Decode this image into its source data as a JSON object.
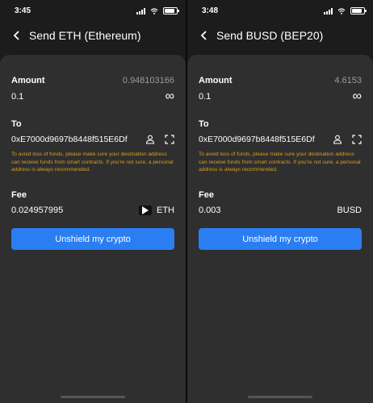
{
  "screens": [
    {
      "status_time": "3:45",
      "title": "Send ETH (Ethereum)",
      "amount_label": "Amount",
      "amount_balance": "0.948103166",
      "amount_value": "0.1",
      "max_symbol": "∞",
      "to_label": "To",
      "to_address": "0xE7000d9697b8448f515E6Df",
      "warning": "To avoid loss of funds, please make sure your destination address can receive funds from smart contracts. If you're not sure, a personal address is always recommended.",
      "fee_label": "Fee",
      "fee_value": "0.024957995",
      "fee_token": "ETH",
      "button_label": "Unshield my crypto",
      "has_token_icon": true
    },
    {
      "status_time": "3:48",
      "title": "Send BUSD (BEP20)",
      "amount_label": "Amount",
      "amount_balance": "4.6153",
      "amount_value": "0.1",
      "max_symbol": "∞",
      "to_label": "To",
      "to_address": "0xE7000d9697b8448f515E6Df",
      "warning": "To avoid loss of funds, please make sure your destination address can receive funds from smart contracts. If you're not sure, a personal address is always recommended.",
      "fee_label": "Fee",
      "fee_value": "0.003",
      "fee_token": "BUSD",
      "button_label": "Unshield my crypto",
      "has_token_icon": false
    }
  ],
  "colors": {
    "accent": "#2a7ef2",
    "warning": "#d99f1e",
    "card": "#2f2f2f",
    "background": "#1c1c1c"
  }
}
